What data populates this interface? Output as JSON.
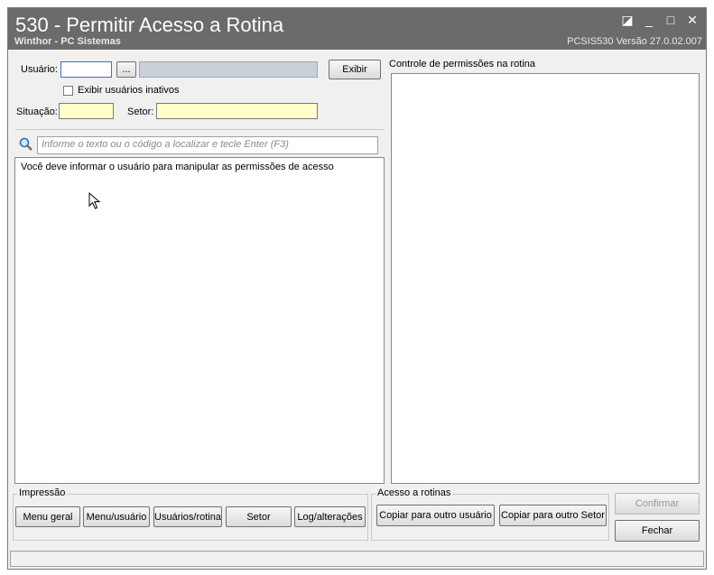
{
  "window": {
    "title": "530 - Permitir Acesso a Rotina",
    "subtitle": "Winthor - PC Sistemas",
    "version": "PCSIS530  Versão  27.0.02.007"
  },
  "left": {
    "usuario_label": "Usuário:",
    "usuario_value": "",
    "browse_label": "...",
    "exibir_label": "Exibir",
    "inativos_label": "Exibir usuários inativos",
    "situacao_label": "Situação:",
    "setor_label": "Setor:",
    "search_placeholder": "Informe o texto ou o código a localizar e tecle Enter (F3)",
    "list_message": "Você deve informar o usuário para manipular as permissões de acesso"
  },
  "right": {
    "panel_title": "Controle de permissões na rotina"
  },
  "impressao": {
    "group_label": "Impressão",
    "buttons": [
      "Menu geral",
      "Menu/usuário",
      "Usuários/rotina",
      "Setor",
      "Log/alterações"
    ]
  },
  "acesso": {
    "group_label": "Acesso a rotinas",
    "buttons": [
      "Copiar para outro usuário",
      "Copiar para outro Setor"
    ]
  },
  "actions": {
    "confirmar": "Confirmar",
    "fechar": "Fechar"
  },
  "icons": [
    "search-icon",
    "cursor-icon",
    "restore-icon",
    "minimize-icon",
    "maximize-icon",
    "close-icon"
  ]
}
